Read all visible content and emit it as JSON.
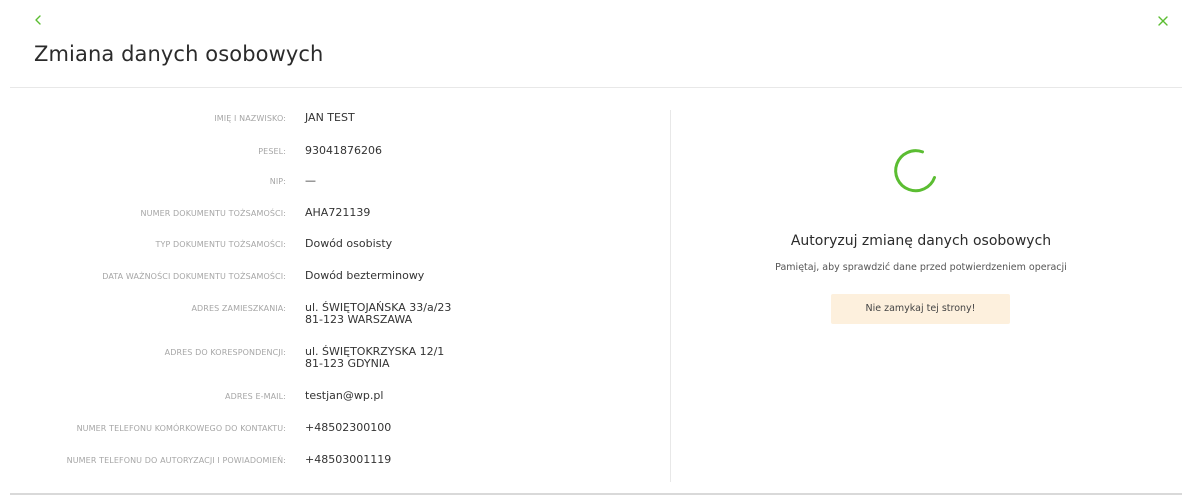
{
  "header": {
    "title": "Zmiana danych osobowych",
    "back_icon": "chevron-left-icon",
    "close_icon": "close-icon",
    "accent_color": "#5bbd32"
  },
  "details": [
    {
      "label": "IMIĘ I NAZWISKO:",
      "value": "JAN TEST"
    },
    {
      "label": "PESEL:",
      "value": "93041876206"
    },
    {
      "label": "NIP:",
      "value": "—"
    },
    {
      "label": "NUMER DOKUMENTU TOŻSAMOŚCI:",
      "value": "AHA721139"
    },
    {
      "label": "TYP DOKUMENTU TOŻSAMOŚCI:",
      "value": "Dowód osobisty"
    },
    {
      "label": "DATA WAŻNOŚCI DOKUMENTU TOŻSAMOŚCI:",
      "value": "Dowód bezterminowy"
    },
    {
      "label": "ADRES ZAMIESZKANIA:",
      "value_line1": "ul. ŚWIĘTOJAŃSKA 33/a/23",
      "value_line2": "81-123 WARSZAWA"
    },
    {
      "label": "ADRES DO KORESPONDENCJI:",
      "value_line1": "ul. ŚWIĘTOKRZYSKA 12/1",
      "value_line2": "81-123 GDYNIA"
    },
    {
      "label": "ADRES E-MAIL:",
      "value": "testjan@wp.pl"
    },
    {
      "label": "NUMER TELEFONU KOMÓRKOWEGO DO KONTAKTU:",
      "value": "+48502300100"
    },
    {
      "label": "NUMER TELEFONU DO AUTORYZACJI I POWIADOMIEŃ:",
      "value": "+48503001119"
    }
  ],
  "authorization": {
    "spinner_icon": "loading-spinner-icon",
    "title": "Autoryzuj zmianę danych osobowych",
    "subtitle": "Pamiętaj, aby sprawdzić dane przed potwierdzeniem operacji",
    "warning": "Nie zamykaj tej strony!",
    "warning_bg": "#fdf0dd"
  }
}
